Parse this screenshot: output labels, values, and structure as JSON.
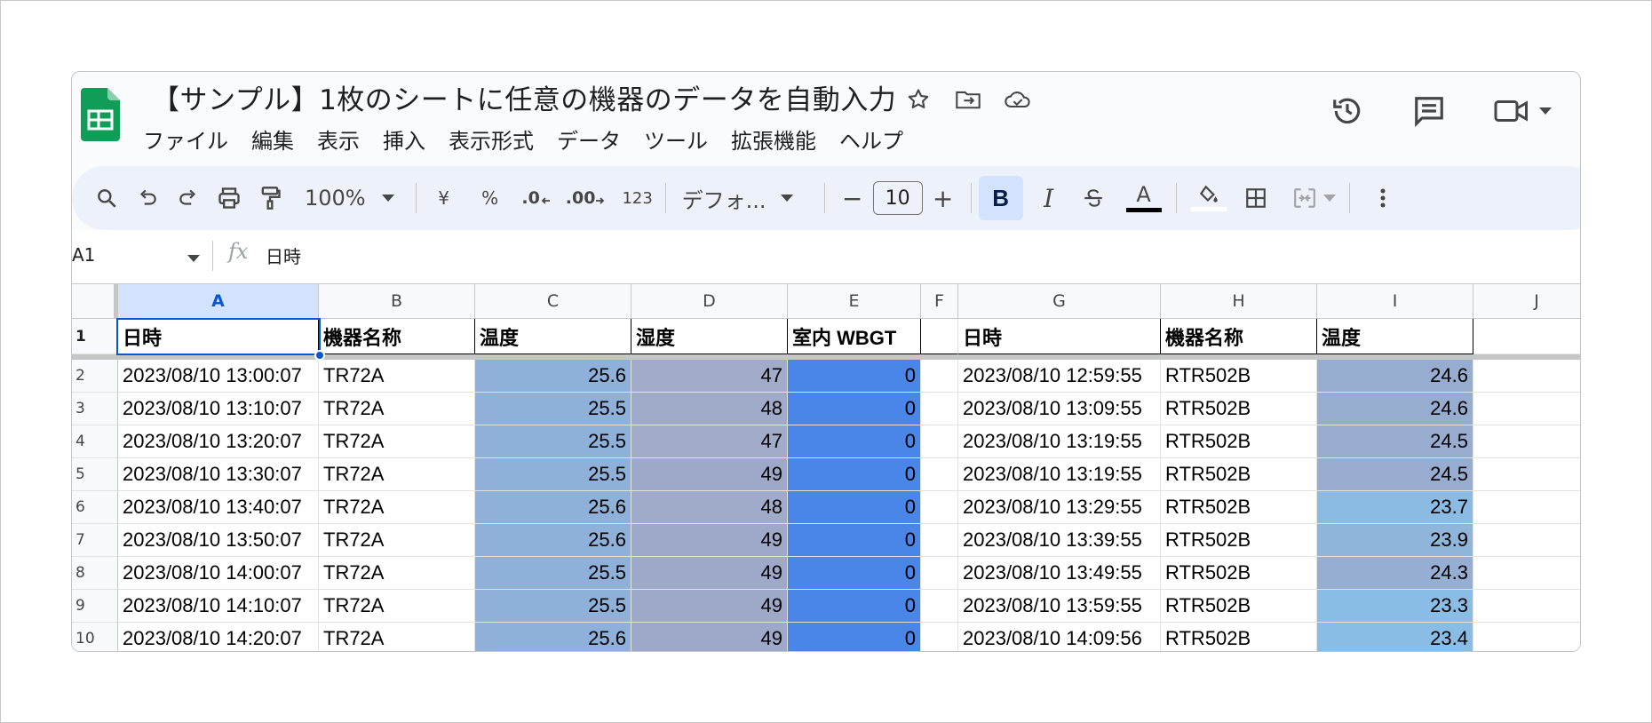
{
  "document": {
    "title": "【サンプル】1枚のシートに任意の機器のデータを自動入力"
  },
  "menu": [
    "ファイル",
    "編集",
    "表示",
    "挿入",
    "表示形式",
    "データ",
    "ツール",
    "拡張機能",
    "ヘルプ"
  ],
  "toolbar": {
    "zoom": "100%",
    "currency": "¥",
    "percent": "%",
    "decrease_decimal": ".0",
    "increase_decimal": ".00",
    "number_format": "123",
    "font": "デフォ...",
    "font_size": "10",
    "bold": "B",
    "italic": "I",
    "text_color_glyph": "A",
    "minus": "−",
    "plus": "+"
  },
  "formula_bar": {
    "name_box": "A1",
    "fx": "fx",
    "value": "日時"
  },
  "columns": [
    "A",
    "B",
    "C",
    "D",
    "E",
    "F",
    "G",
    "H",
    "I",
    "J"
  ],
  "row_numbers": [
    "1",
    "2",
    "3",
    "4",
    "5",
    "6",
    "7",
    "8",
    "9",
    "10"
  ],
  "header_row": {
    "A": "日時",
    "B": "機器名称",
    "C": "温度",
    "D": "湿度",
    "E": "室内 WBGT",
    "F": "",
    "G": "日時",
    "H": "機器名称",
    "I": "温度"
  },
  "rows": [
    [
      "2023/08/10 13:00:07",
      "TR72A",
      "25.6",
      "47",
      "0",
      "",
      "2023/08/10 12:59:55",
      "RTR502B",
      "24.6"
    ],
    [
      "2023/08/10 13:10:07",
      "TR72A",
      "25.5",
      "48",
      "0",
      "",
      "2023/08/10 13:09:55",
      "RTR502B",
      "24.6"
    ],
    [
      "2023/08/10 13:20:07",
      "TR72A",
      "25.5",
      "47",
      "0",
      "",
      "2023/08/10 13:19:55",
      "RTR502B",
      "24.5"
    ],
    [
      "2023/08/10 13:30:07",
      "TR72A",
      "25.5",
      "49",
      "0",
      "",
      "2023/08/10 13:19:55",
      "RTR502B",
      "24.5"
    ],
    [
      "2023/08/10 13:40:07",
      "TR72A",
      "25.6",
      "48",
      "0",
      "",
      "2023/08/10 13:29:55",
      "RTR502B",
      "23.7"
    ],
    [
      "2023/08/10 13:50:07",
      "TR72A",
      "25.6",
      "49",
      "0",
      "",
      "2023/08/10 13:39:55",
      "RTR502B",
      "23.9"
    ],
    [
      "2023/08/10 14:00:07",
      "TR72A",
      "25.5",
      "49",
      "0",
      "",
      "2023/08/10 13:49:55",
      "RTR502B",
      "24.3"
    ],
    [
      "2023/08/10 14:10:07",
      "TR72A",
      "25.5",
      "49",
      "0",
      "",
      "2023/08/10 13:59:55",
      "RTR502B",
      "23.3"
    ],
    [
      "2023/08/10 14:20:07",
      "TR72A",
      "25.6",
      "49",
      "0",
      "",
      "2023/08/10 14:09:56",
      "RTR502B",
      "23.4"
    ]
  ],
  "cell_colors": {
    "C": [
      "#8fb1d9",
      "#8fb1d9",
      "#8fb1d9",
      "#8fb1d9",
      "#8fb1d9",
      "#8fb1d9",
      "#8fb1d9",
      "#8fb1d9",
      "#8fb1d9"
    ],
    "D": [
      "#a2acc9",
      "#a0aac9",
      "#a2acc9",
      "#9ea8c8",
      "#a0aac9",
      "#9ea8c8",
      "#9ea8c8",
      "#9ea8c8",
      "#9ea8c8"
    ],
    "E": [
      "#4a86e8",
      "#4a86e8",
      "#4a86e8",
      "#4a86e8",
      "#4a86e8",
      "#4a86e8",
      "#4a86e8",
      "#4a86e8",
      "#4a86e8"
    ],
    "I": [
      "#96adcf",
      "#96adcf",
      "#97acce",
      "#97acce",
      "#8bbbe3",
      "#90b5da",
      "#95aed2",
      "#8abde5",
      "#8abde5"
    ]
  },
  "colors": {
    "accent": "#0b57d0",
    "selected_header": "#d3e3fd",
    "toolbar_bg": "#edf2fa",
    "sheets_green": "#0f9d58"
  }
}
